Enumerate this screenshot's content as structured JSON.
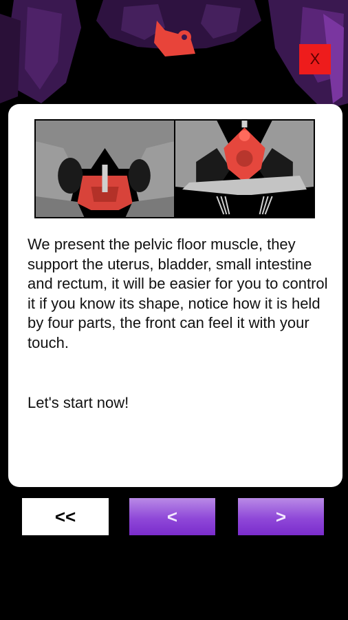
{
  "close_button": {
    "label": "X"
  },
  "dialog": {
    "body": "We present the pelvic floor muscle, they support the uterus, bladder, small intestine and rectum, it will be easier for you to control it if you know its shape, notice how it is held by four parts, the front can feel it with your touch.",
    "closing": "Let's start now!"
  },
  "navigation": {
    "first_label": "<<",
    "prev_label": "<",
    "next_label": ">"
  },
  "colors": {
    "close_red": "#ee1c1c",
    "nav_purple": "#8f48d8",
    "muscle_red": "#e8443a",
    "backdrop_purple": "#3b1a52"
  }
}
